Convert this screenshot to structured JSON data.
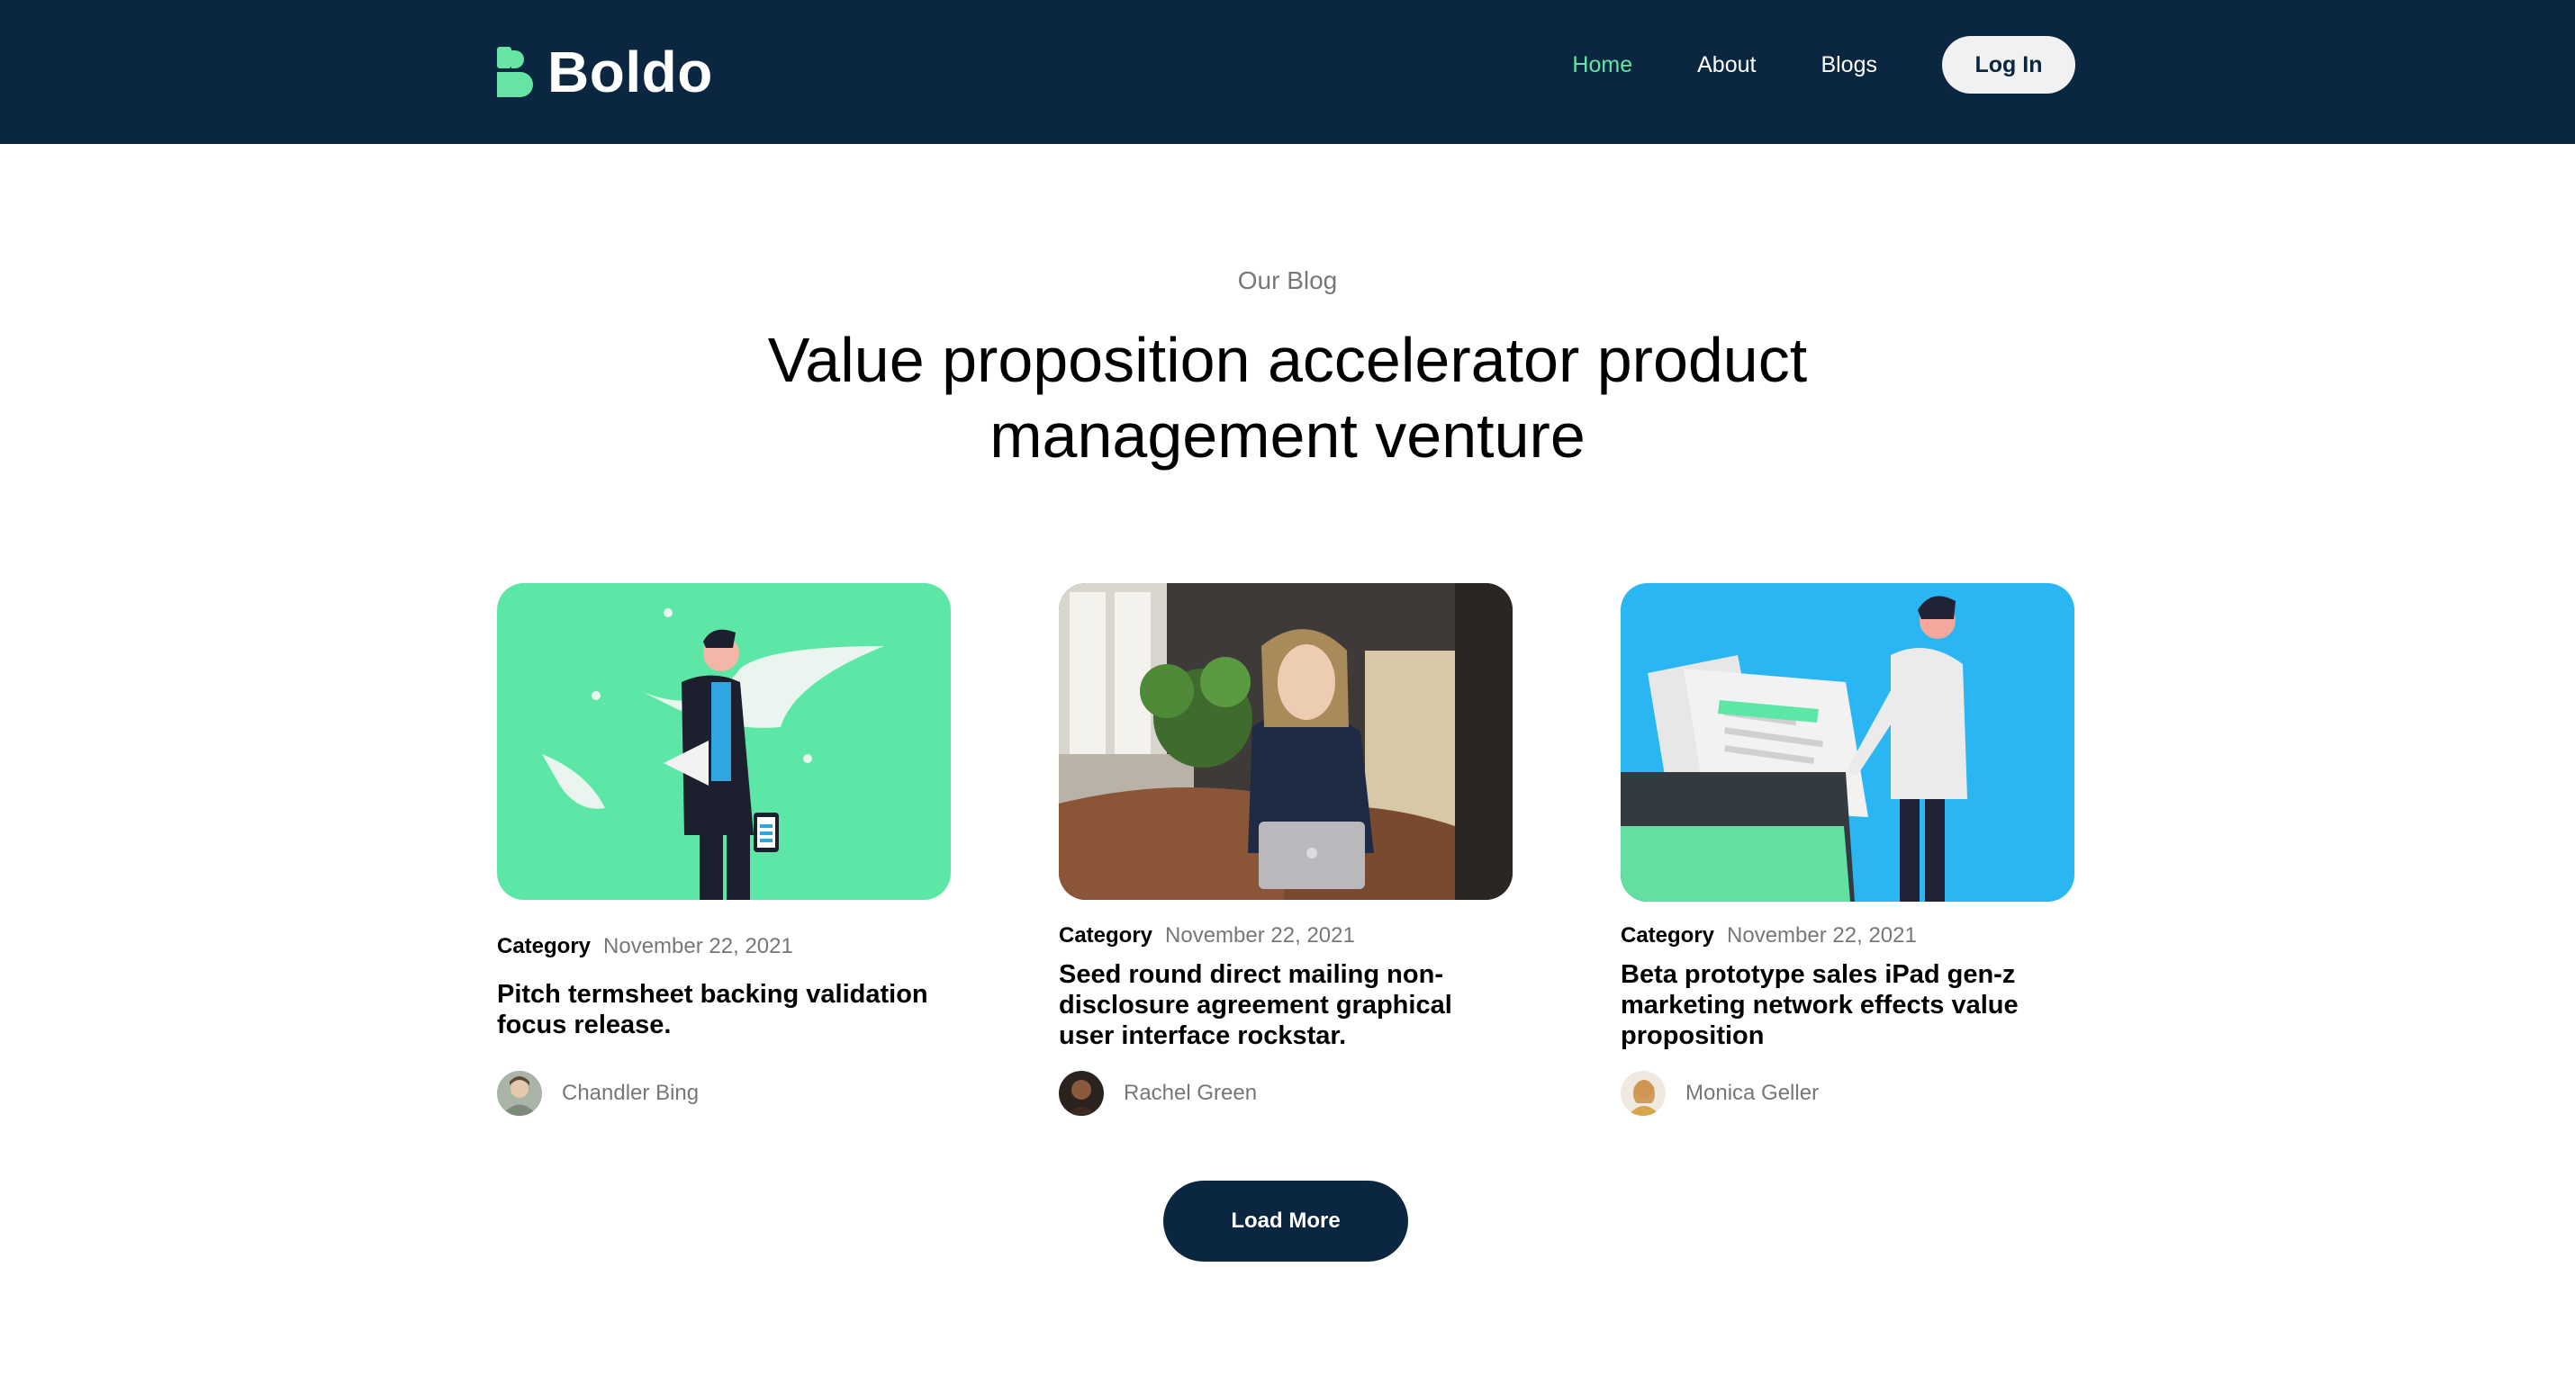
{
  "brand": {
    "name": "Boldo",
    "logo_color": "#65e4a3",
    "nav_bg": "#0a2640"
  },
  "nav": {
    "links": [
      "Home",
      "About",
      "Blogs"
    ],
    "active": "Home",
    "login_label": "Log In"
  },
  "section": {
    "eyebrow": "Our Blog",
    "headline": "Value proposition accelerator product management venture"
  },
  "posts": [
    {
      "image": "illustration-man-with-phone-green",
      "category": "Category",
      "date": "November 22, 2021",
      "title": "Pitch termsheet backing validation focus release.",
      "author": "Chandler Bing"
    },
    {
      "image": "photo-woman-on-phone-with-laptop",
      "category": "Category",
      "date": "November 22, 2021",
      "title": "Seed round direct mailing non-disclosure agreement graphical user interface rockstar.",
      "author": "Rachel Green"
    },
    {
      "image": "illustration-man-with-documents-blue",
      "category": "Category",
      "date": "November 22, 2021",
      "title": "Beta prototype sales iPad gen-z marketing network effects value proposition",
      "author": "Monica Geller"
    }
  ],
  "load_more_label": "Load More"
}
